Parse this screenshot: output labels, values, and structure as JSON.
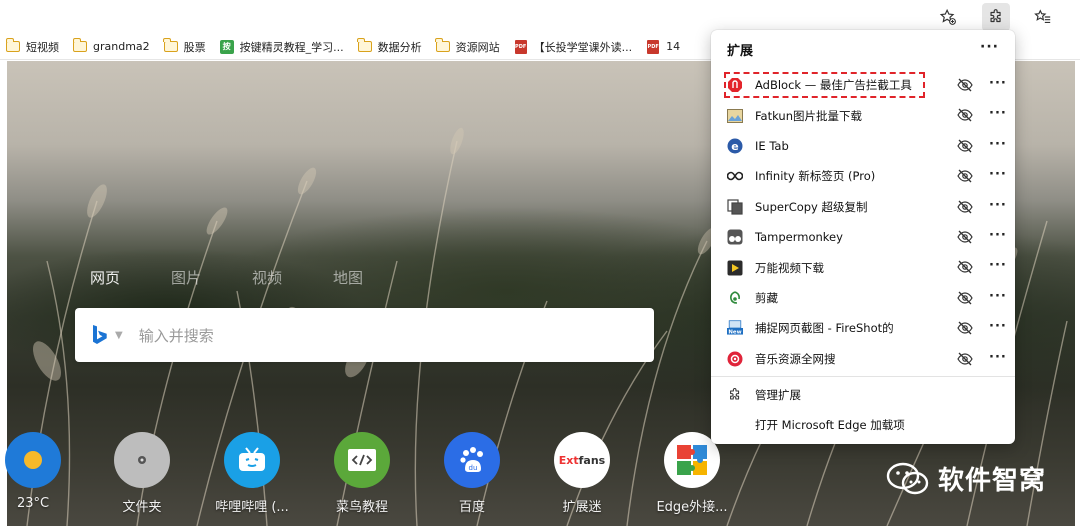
{
  "toolbar": {
    "favorites_icon": "star-plus-icon",
    "extensions_icon": "puzzle-icon",
    "collections_icon": "star-list-icon"
  },
  "bookmarks": [
    {
      "label": "短视频",
      "icon": "folder"
    },
    {
      "label": "grandma2",
      "icon": "folder"
    },
    {
      "label": "股票",
      "icon": "folder"
    },
    {
      "label": "按键精灵教程_学习...",
      "icon": "green-app"
    },
    {
      "label": "数据分析",
      "icon": "folder"
    },
    {
      "label": "资源网站",
      "icon": "folder"
    },
    {
      "label": "【长投学堂课外读...",
      "icon": "pdf"
    },
    {
      "label": "14",
      "icon": "pdf"
    }
  ],
  "search": {
    "tabs": [
      "网页",
      "图片",
      "视频",
      "地图"
    ],
    "placeholder": "输入并搜索"
  },
  "quick_links": [
    {
      "label": "23°C",
      "icon": "weather-sun-icon",
      "color": "#1f7ad8"
    },
    {
      "label": "文件夹",
      "icon": "folder-icon",
      "color": "#bdbdbd"
    },
    {
      "label": "哔哩哔哩 (...",
      "icon": "bilibili-icon",
      "color": "#1aa0e6"
    },
    {
      "label": "菜鸟教程",
      "icon": "code-icon",
      "color": "#5ba83a"
    },
    {
      "label": "百度",
      "icon": "baidu-paw-icon",
      "color": "#2b6de6"
    },
    {
      "label": "扩展迷",
      "icon": "extfans-icon",
      "color": "#ffffff"
    },
    {
      "label": "Edge外接...",
      "icon": "puzzle-color-icon",
      "color": "#ffffff"
    }
  ],
  "extensions_panel": {
    "title": "扩展",
    "items": [
      {
        "name": "AdBlock — 最佳广告拦截工具",
        "icon": "adblock-icon",
        "color": "#e3252b",
        "highlighted": true
      },
      {
        "name": "Fatkun图片批量下载",
        "icon": "image-icon",
        "color": "#6aa2d8"
      },
      {
        "name": "IE Tab",
        "icon": "ie-tab-icon",
        "color": "#2b5aa8"
      },
      {
        "name": "Infinity 新标签页 (Pro)",
        "icon": "infinity-icon",
        "color": "#222222"
      },
      {
        "name": "SuperCopy 超级复制",
        "icon": "copy-icon",
        "color": "#555555"
      },
      {
        "name": "Tampermonkey",
        "icon": "tampermonkey-icon",
        "color": "#555555"
      },
      {
        "name": "万能视频下载",
        "icon": "video-download-icon",
        "color": "#2b2b2b"
      },
      {
        "name": "剪藏",
        "icon": "clip-icon",
        "color": "#2f8a3c"
      },
      {
        "name": "捕捉网页截图 - FireShot的",
        "icon": "fireshot-icon",
        "color": "#1e6fc2"
      },
      {
        "name": "音乐资源全网搜",
        "icon": "music-search-icon",
        "color": "#e0243a"
      }
    ],
    "footer": {
      "manage_label": "管理扩展",
      "addons_label": "打开 Microsoft Edge 加载项"
    }
  },
  "watermark": {
    "text": "软件智窝"
  }
}
